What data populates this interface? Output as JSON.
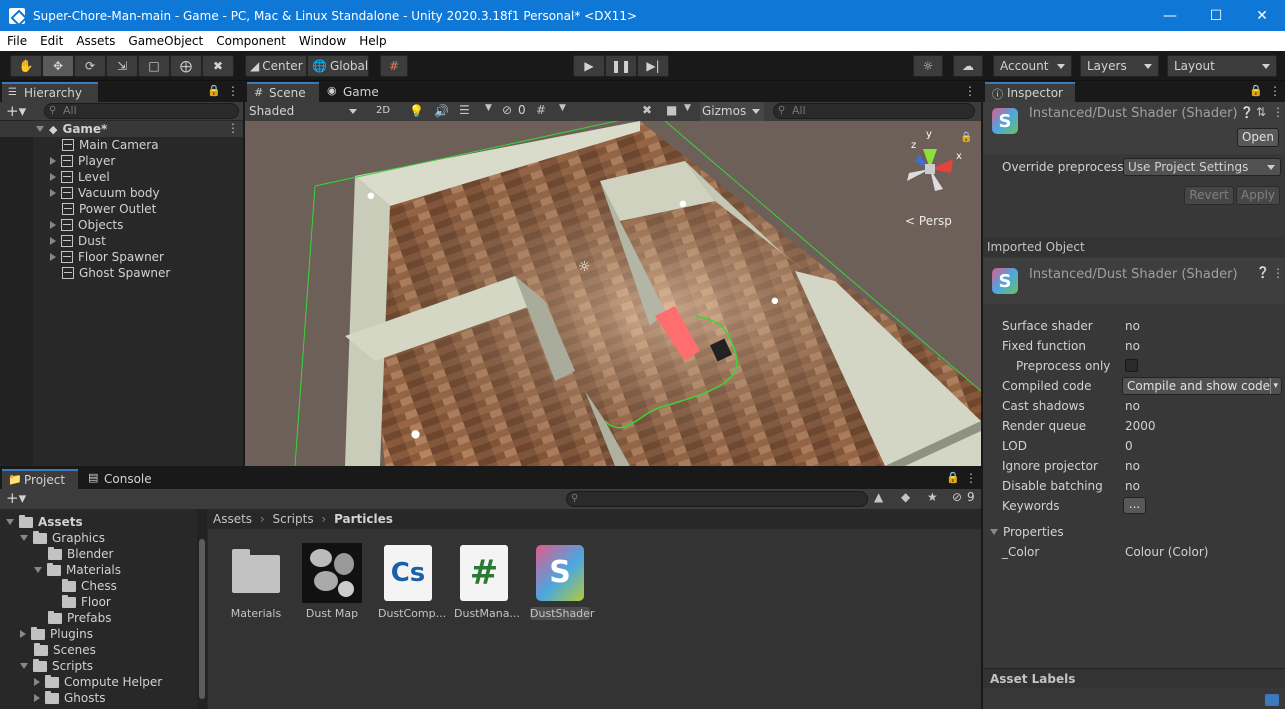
{
  "window": {
    "title": "Super-Chore-Man-main - Game - PC, Mac & Linux Standalone - Unity 2020.3.18f1 Personal* <DX11>"
  },
  "menu": [
    "File",
    "Edit",
    "Assets",
    "GameObject",
    "Component",
    "Window",
    "Help"
  ],
  "toolbar": {
    "center": "Center",
    "global": "Global",
    "account": "Account",
    "layers": "Layers",
    "layout": "Layout"
  },
  "hierarchy": {
    "tab": "Hierarchy",
    "search_placeholder": "All",
    "root": "Game*",
    "items": [
      "Main Camera",
      "Player",
      "Level",
      "Vacuum body",
      "Power Outlet",
      "Objects",
      "Dust",
      "Floor Spawner",
      "Ghost Spawner"
    ]
  },
  "scene": {
    "tabs": [
      "Scene",
      "Game"
    ],
    "shading": "Shaded",
    "mode2d": "2D",
    "hidden_count": "0",
    "gizmos": "Gizmos",
    "search_placeholder": "All",
    "persp": "Persp",
    "axis_y": "y",
    "axis_x": "x",
    "axis_z": "z"
  },
  "project": {
    "tabs": [
      "Project",
      "Console"
    ],
    "hidden_count": "9",
    "tree": [
      {
        "label": "Assets",
        "depth": 0
      },
      {
        "label": "Graphics",
        "depth": 1
      },
      {
        "label": "Blender",
        "depth": 2
      },
      {
        "label": "Materials",
        "depth": 2
      },
      {
        "label": "Chess",
        "depth": 3
      },
      {
        "label": "Floor",
        "depth": 3
      },
      {
        "label": "Prefabs",
        "depth": 2
      },
      {
        "label": "Plugins",
        "depth": 1
      },
      {
        "label": "Scenes",
        "depth": 1
      },
      {
        "label": "Scripts",
        "depth": 1
      },
      {
        "label": "Compute Helper",
        "depth": 2
      },
      {
        "label": "Ghosts",
        "depth": 2
      }
    ],
    "breadcrumb": [
      "Assets",
      "Scripts",
      "Particles"
    ],
    "assets": [
      "Materials",
      "Dust Map",
      "DustComp...",
      "DustMana...",
      "DustShader"
    ],
    "asset_glyphs": {
      "cs": "Cs",
      "hash": "#",
      "shader": "S"
    }
  },
  "inspector": {
    "tab": "Inspector",
    "title": "Instanced/Dust Shader (Shader)",
    "open": "Open",
    "override_label": "Override preprocesso",
    "override_value": "Use Project Settings",
    "revert": "Revert",
    "apply": "Apply",
    "imported_object": "Imported Object",
    "imported_title": "Instanced/Dust Shader (Shader)",
    "props": [
      {
        "k": "Surface shader",
        "v": "no"
      },
      {
        "k": "Fixed function",
        "v": "no"
      },
      {
        "k": "Preprocess only",
        "v": ""
      },
      {
        "k": "Compiled code",
        "v": "Compile and show code"
      },
      {
        "k": "Cast shadows",
        "v": "no"
      },
      {
        "k": "Render queue",
        "v": "2000"
      },
      {
        "k": "LOD",
        "v": "0"
      },
      {
        "k": "Ignore projector",
        "v": "no"
      },
      {
        "k": "Disable batching",
        "v": "no"
      },
      {
        "k": "Keywords",
        "v": "..."
      }
    ],
    "properties_header": "Properties",
    "color_prop": "_Color",
    "color_value": "Colour (Color)",
    "asset_labels": "Asset Labels"
  }
}
